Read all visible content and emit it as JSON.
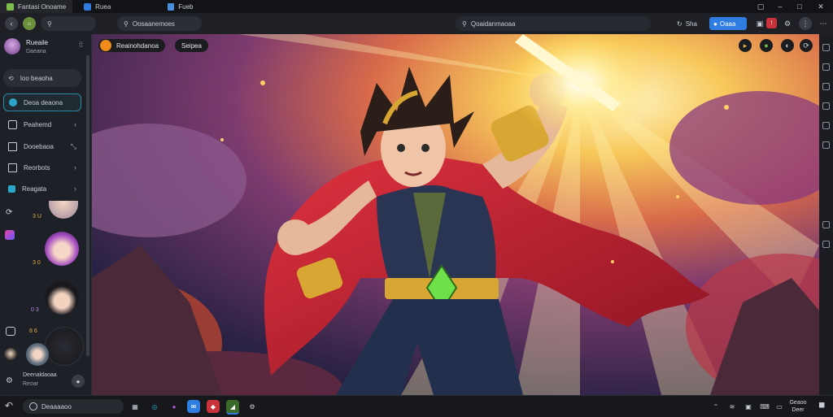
{
  "window": {
    "tabs": [
      {
        "label": "Fantasi Onoame",
        "icon": "app-logo-icon"
      },
      {
        "label": "Ruea",
        "icon": "app-tab-icon"
      },
      {
        "label": "Fueb",
        "icon": "doc-tab-icon"
      }
    ]
  },
  "toolbar": {
    "back_label": "",
    "search_placeholder": "Oosaanemoes",
    "address_value": "Qoaidanmaoaa",
    "share_label": "Sha",
    "primary_button_label": "Oaaa"
  },
  "sidebar": {
    "profile": {
      "name": "Rueaile",
      "subtitle": "Daeana"
    },
    "search_label": "Ioo beaoha",
    "items": [
      {
        "label": "Deoa deaona",
        "icon": "compass-icon",
        "active": true
      },
      {
        "label": "Peahemd",
        "icon": "calendar-icon"
      },
      {
        "label": "Dooebaoa",
        "icon": "square-icon"
      },
      {
        "label": "Reorbots",
        "icon": "book-icon"
      },
      {
        "label": "Reagata",
        "icon": "leaf-icon"
      }
    ],
    "gallery": [
      {
        "caption": "3 U"
      },
      {
        "caption": "3 0"
      },
      {
        "caption": "0 3"
      },
      {
        "caption": "8 6"
      }
    ],
    "footer": {
      "title": "Deenaldaoaa",
      "subtitle": "Reoar"
    }
  },
  "main": {
    "chip_label": "Reainohdanoa",
    "status_label": "Seipea",
    "action_icons": [
      "play-icon",
      "leaf-icon",
      "dot-icon",
      "refresh-icon"
    ]
  },
  "taskbar": {
    "search_label": "Deaaaaoo",
    "clock_time": "Geaoo",
    "clock_date": "Deer"
  },
  "colors": {
    "accent": "#2f7de1",
    "sidebar_active": "#2a8aa8",
    "brand_orange": "#f08a1a"
  }
}
